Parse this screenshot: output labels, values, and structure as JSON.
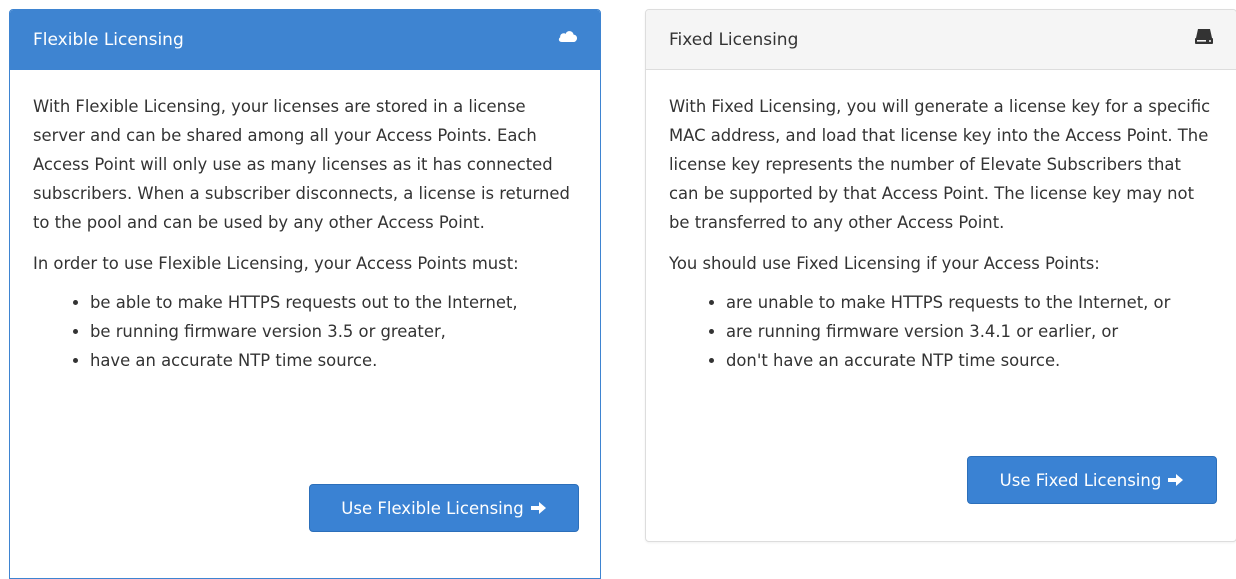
{
  "flexible": {
    "title": "Flexible Licensing",
    "heading_icon": "cloud-icon",
    "paragraph1": "With Flexible Licensing, your licenses are stored in a license server and can be shared among all your Access Points. Each Access Point will only use as many licenses as it has connected subscribers. When a subscriber disconnects, a license is returned to the pool and can be used by any other Access Point.",
    "paragraph2": "In order to use Flexible Licensing, your Access Points must:",
    "requirements": [
      "be able to make HTTPS requests out to the Internet,",
      "be running firmware version 3.5 or greater,",
      "have an accurate NTP time source."
    ],
    "button_label": "Use Flexible Licensing",
    "button_icon": "arrow-right-icon"
  },
  "fixed": {
    "title": "Fixed Licensing",
    "heading_icon": "hdd-icon",
    "paragraph1": "With Fixed Licensing, you will generate a license key for a specific MAC address, and load that license key into the Access Point. The license key represents the number of Elevate Subscribers that can be supported by that Access Point. The license key may not be transferred to any other Access Point.",
    "paragraph2": "You should use Fixed Licensing if your Access Points:",
    "conditions": [
      "are unable to make HTTPS requests to the Internet, or",
      "are running firmware version 3.4.1 or earlier, or",
      "don't have an accurate NTP time source."
    ],
    "button_label": "Use Fixed Licensing",
    "button_icon": "arrow-right-icon"
  },
  "colors": {
    "primary": "#3e84d1",
    "button": "#3a82d3",
    "text": "#333333",
    "heading_bg_default": "#f5f5f5"
  }
}
